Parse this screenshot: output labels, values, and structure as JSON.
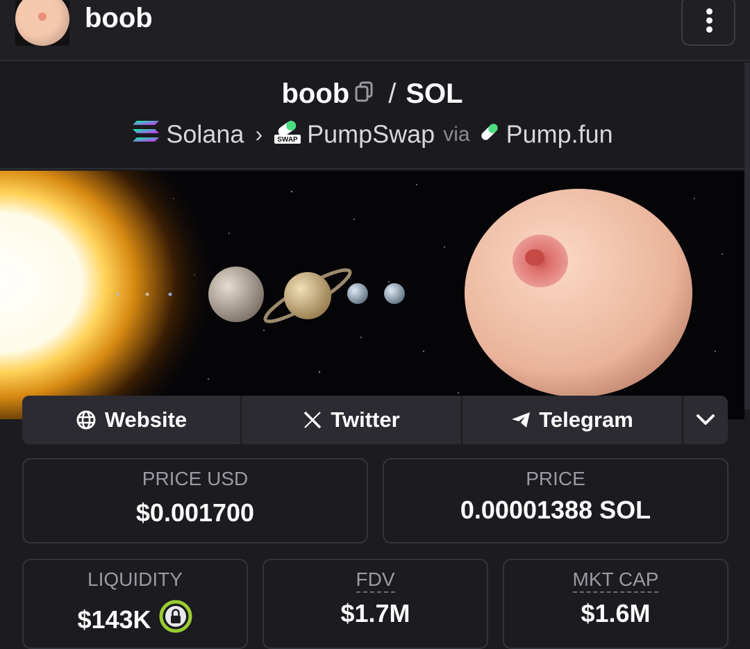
{
  "header": {
    "title": "boob"
  },
  "pair": {
    "base": "boob",
    "quote": "SOL",
    "separator": "/"
  },
  "route": {
    "chain": "Solana",
    "dex": "PumpSwap",
    "via": "via",
    "launchpad": "Pump.fun",
    "swap_badge": "SWAP"
  },
  "links": {
    "website": "Website",
    "twitter": "Twitter",
    "telegram": "Telegram"
  },
  "stats": {
    "price_usd_label": "PRICE USD",
    "price_usd": "$0.001700",
    "price_label": "PRICE",
    "price_native": "0.00001388 SOL",
    "liquidity_label": "LIQUIDITY",
    "liquidity": "$143K",
    "fdv_label": "FDV",
    "fdv": "$1.7M",
    "mktcap_label": "MKT CAP",
    "mktcap": "$1.6M"
  },
  "colors": {
    "background": "#1b1b20",
    "panel": "#2b2b31",
    "lock_ring": "#9acd32"
  }
}
